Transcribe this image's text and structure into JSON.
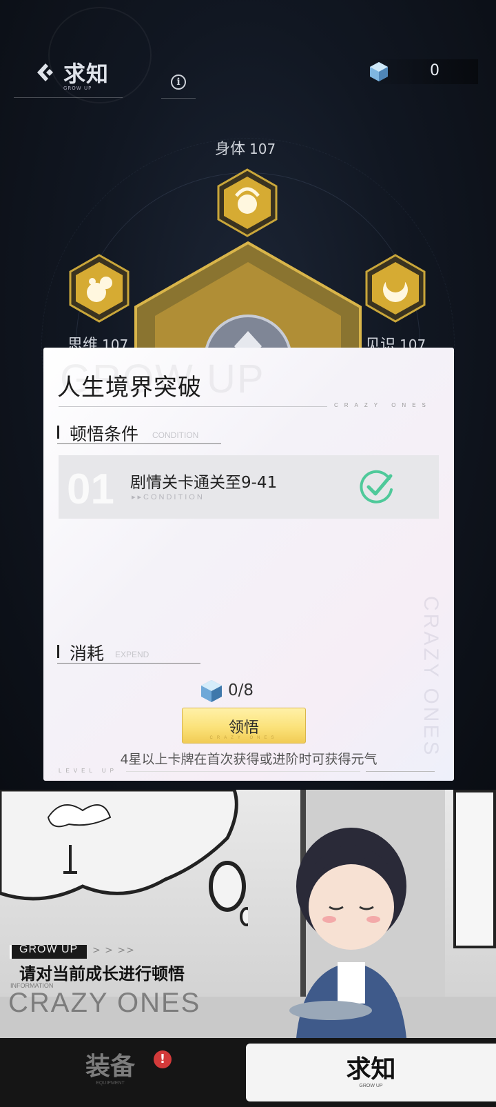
{
  "header": {
    "title": "求知",
    "title_sub": "GROW UP",
    "info_symbol": "i",
    "currency_icon": "crystal-cube-icon",
    "currency_value": "0"
  },
  "attributes": [
    {
      "name": "身体",
      "value": "107",
      "icon": "flame-emblem-icon"
    },
    {
      "name": "思维",
      "value": "107",
      "icon": "swirl-cloud-icon"
    },
    {
      "name": "见识",
      "value": "107",
      "icon": "crescent-moon-icon"
    }
  ],
  "dialog": {
    "watermark": "GROW UP",
    "title": "人生境界突破",
    "title_tag": "CRAZY ONES",
    "condition_section": {
      "title": "顿悟条件",
      "subtitle": "CONDITION"
    },
    "conditions": [
      {
        "index": "01",
        "text": "剧情关卡通关至9-41",
        "sub": "CONDITION",
        "completed": true
      }
    ],
    "expend_section": {
      "title": "消耗",
      "subtitle": "EXPEND"
    },
    "cost": {
      "icon": "crystal-cube-icon",
      "value": "0/8"
    },
    "claim_button": {
      "label": "领悟",
      "tag": "CRAZY ONES"
    },
    "hint": "4星以上卡牌在首次获得或进阶时可获得元气",
    "footer_tag": "LEVEL UP",
    "side_watermark": "CRAZY ONES"
  },
  "comic": {
    "tag": "GROW UP",
    "chevrons": "> > >>",
    "caption": "请对当前成长进行顿悟",
    "info_label": "INFORMATION",
    "watermark": "CRAZY ONES"
  },
  "bottom_nav": {
    "tabs": [
      {
        "label": "装备",
        "sub": "EQUIPMENT",
        "badge": "!",
        "active": false
      },
      {
        "label": "求知",
        "sub": "GROW UP",
        "active": true
      }
    ]
  },
  "colors": {
    "accent_gold": "#f1cc55",
    "check_green": "#4fc99a",
    "badge_red": "#d33a3a"
  }
}
